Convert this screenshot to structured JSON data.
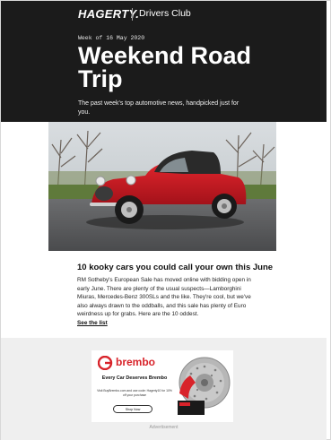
{
  "header": {
    "brand": "HAGERTY.",
    "club": "Drivers Club",
    "week": "Week of 16 May 2020",
    "headline": "Weekend Road Trip",
    "intro": "The past week's top automotive news, handpicked just for you."
  },
  "article": {
    "image_alt": "Red vintage roadster parked on asphalt with trees behind",
    "title": "10 kooky cars you could call your own this June",
    "body": "RM Sotheby's European Sale has moved online with bidding open in early June. There are plenty of the usual suspects—Lamborghini Miuras, Mercedes-Benz 300SLs and the like. They're cool, but we've also always drawn to the oddballs, and this sale has plenty of Euro weirdness up for grabs. Here are the 10 oddest.",
    "link": "See the list"
  },
  "ad": {
    "logo": "brembo",
    "tagline": "Every Car Deserves Brembo",
    "body": "Visit BuyBrembo.com and use code: Hagerty10 for 10% off your purchase",
    "button": "Shop Now",
    "label": "Advertisement",
    "colors": {
      "brand_red": "#d8232a"
    }
  },
  "colors": {
    "header_bg": "#1b1b1b",
    "ad_section_bg": "#efefef"
  }
}
